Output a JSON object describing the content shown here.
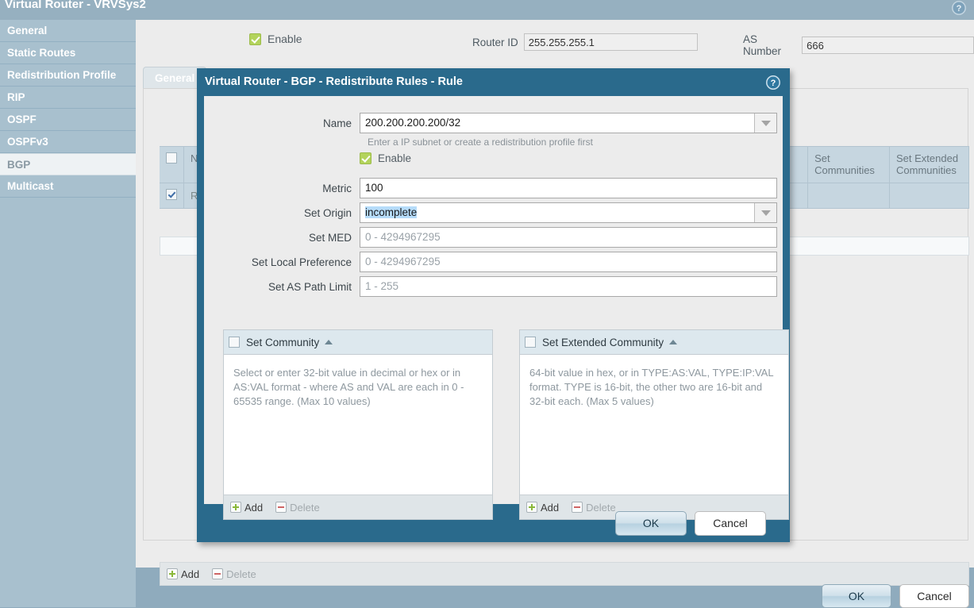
{
  "page": {
    "title": "Virtual Router - VRVSys2",
    "help_icon": "help-circle-icon"
  },
  "sidebar": {
    "items": [
      {
        "label": "General",
        "selected": false
      },
      {
        "label": "Static Routes",
        "selected": false
      },
      {
        "label": "Redistribution Profile",
        "selected": false
      },
      {
        "label": "RIP",
        "selected": false
      },
      {
        "label": "OSPF",
        "selected": false
      },
      {
        "label": "OSPFv3",
        "selected": false
      },
      {
        "label": "BGP",
        "selected": true
      },
      {
        "label": "Multicast",
        "selected": false
      }
    ]
  },
  "toolbar": {
    "enable_label": "Enable",
    "enable_checked": true,
    "router_id_label": "Router ID",
    "router_id_value": "255.255.255.1",
    "as_number_label": "AS Number",
    "as_number_value": "666"
  },
  "tabs": [
    {
      "label": "General",
      "active": true
    }
  ],
  "background_table": {
    "columns": [
      "Name",
      "Set Communities",
      "Set Extended Communities"
    ],
    "rows": [
      {
        "checked": true,
        "name": "Red"
      }
    ],
    "add_label": "Add",
    "delete_label": "Delete"
  },
  "dialog": {
    "title": "Virtual Router - BGP - Redistribute Rules - Rule",
    "help_icon": "help-circle-icon",
    "fields": {
      "name_label": "Name",
      "name_value": "200.200.200.200/32",
      "name_hint": "Enter a IP subnet or create a redistribution profile first",
      "enable_label": "Enable",
      "enable_checked": true,
      "metric_label": "Metric",
      "metric_value": "100",
      "set_origin_label": "Set Origin",
      "set_origin_value": "incomplete",
      "set_med_label": "Set MED",
      "set_med_placeholder": "0 - 4294967295",
      "set_local_pref_label": "Set Local Preference",
      "set_local_pref_placeholder": "0 - 4294967295",
      "set_as_path_limit_label": "Set AS Path Limit",
      "set_as_path_limit_placeholder": "1 - 255"
    },
    "set_community": {
      "title": "Set Community",
      "checked": false,
      "description": "Select or enter 32-bit value in decimal or hex or in AS:VAL format - where AS and VAL are each in 0 - 65535 range. (Max 10 values)",
      "add_label": "Add",
      "delete_label": "Delete"
    },
    "set_extended_community": {
      "title": "Set Extended Community",
      "checked": false,
      "description": "64-bit value in hex, or in TYPE:AS:VAL, TYPE:IP:VAL format. TYPE is 16-bit, the other two are 16-bit and 32-bit each. (Max 5 values)",
      "add_label": "Add",
      "delete_label": "Delete"
    },
    "ok_label": "OK",
    "cancel_label": "Cancel"
  },
  "footer": {
    "ok_label": "OK",
    "cancel_label": "Cancel"
  },
  "colors": {
    "dialog_chrome": "#2a6a8c",
    "sidebar": "#a8c0ce",
    "page_bg": "#8fabbd",
    "accent_check": "#b3d35c",
    "selection_highlight": "#b6dcfa"
  }
}
